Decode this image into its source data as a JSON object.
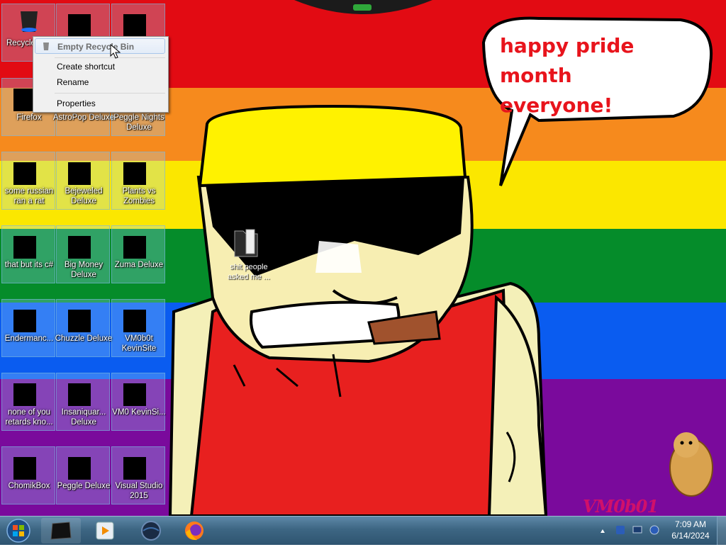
{
  "wallpaper": {
    "speech_text_line1": "happy pride month",
    "speech_text_line2": "everyone!",
    "signature": "VM0b01",
    "stripe_colors": [
      "#e20b13",
      "#f68a1d",
      "#fbe700",
      "#058c2a",
      "#0a5cf0",
      "#7a0a9c"
    ]
  },
  "desktop_icons": [
    {
      "name": "recycle-bin-icon",
      "label": "Recycle Bin"
    },
    {
      "name": "hidden-icon-1",
      "label": ""
    },
    {
      "name": "hidden-icon-2",
      "label": ""
    },
    {
      "name": "firefox-icon",
      "label": "Firefox"
    },
    {
      "name": "astropop-icon",
      "label": "AstroPop Deluxe"
    },
    {
      "name": "peggle-nights-icon",
      "label": "Peggle Nights Deluxe"
    },
    {
      "name": "russian-rat-icon",
      "label": "some russian ran a rat"
    },
    {
      "name": "bejeweled-icon",
      "label": "Bejeweled Deluxe"
    },
    {
      "name": "plants-vs-zombies-icon",
      "label": "Plants vs Zombies"
    },
    {
      "name": "that-but-its-csharp-icon",
      "label": "that but its c#"
    },
    {
      "name": "big-money-icon",
      "label": "Big Money Deluxe"
    },
    {
      "name": "zuma-icon",
      "label": "Zuma Deluxe"
    },
    {
      "name": "endermanc-icon",
      "label": "Endermanc..."
    },
    {
      "name": "chuzzle-icon",
      "label": "Chuzzle Deluxe"
    },
    {
      "name": "vm0b0t-kevinsite-icon",
      "label": "VM0b0t KevinSite"
    },
    {
      "name": "none-of-you-icon",
      "label": "none of you retards kno..."
    },
    {
      "name": "insaniquarium-icon",
      "label": "Insaniquar... Deluxe"
    },
    {
      "name": "vm0-kevinsi-icon",
      "label": "VM0 KevinSi..."
    },
    {
      "name": "chomikbox-icon",
      "label": "ChomikBox"
    },
    {
      "name": "peggle-deluxe-icon",
      "label": "Peggle Deluxe"
    },
    {
      "name": "visual-studio-icon",
      "label": "Visual Studio 2015"
    }
  ],
  "desktop_file": {
    "label": "shit people asked me ..."
  },
  "context_menu": {
    "items": [
      "Empty Recycle Bin",
      "Create shortcut",
      "Rename",
      "Properties"
    ]
  },
  "taskbar": {
    "pinned": [
      "black-box-icon",
      "media-player-icon",
      "dark-globe-icon",
      "firefox-icon"
    ],
    "clock_time": "7:09 AM",
    "clock_date": "6/14/2024"
  }
}
